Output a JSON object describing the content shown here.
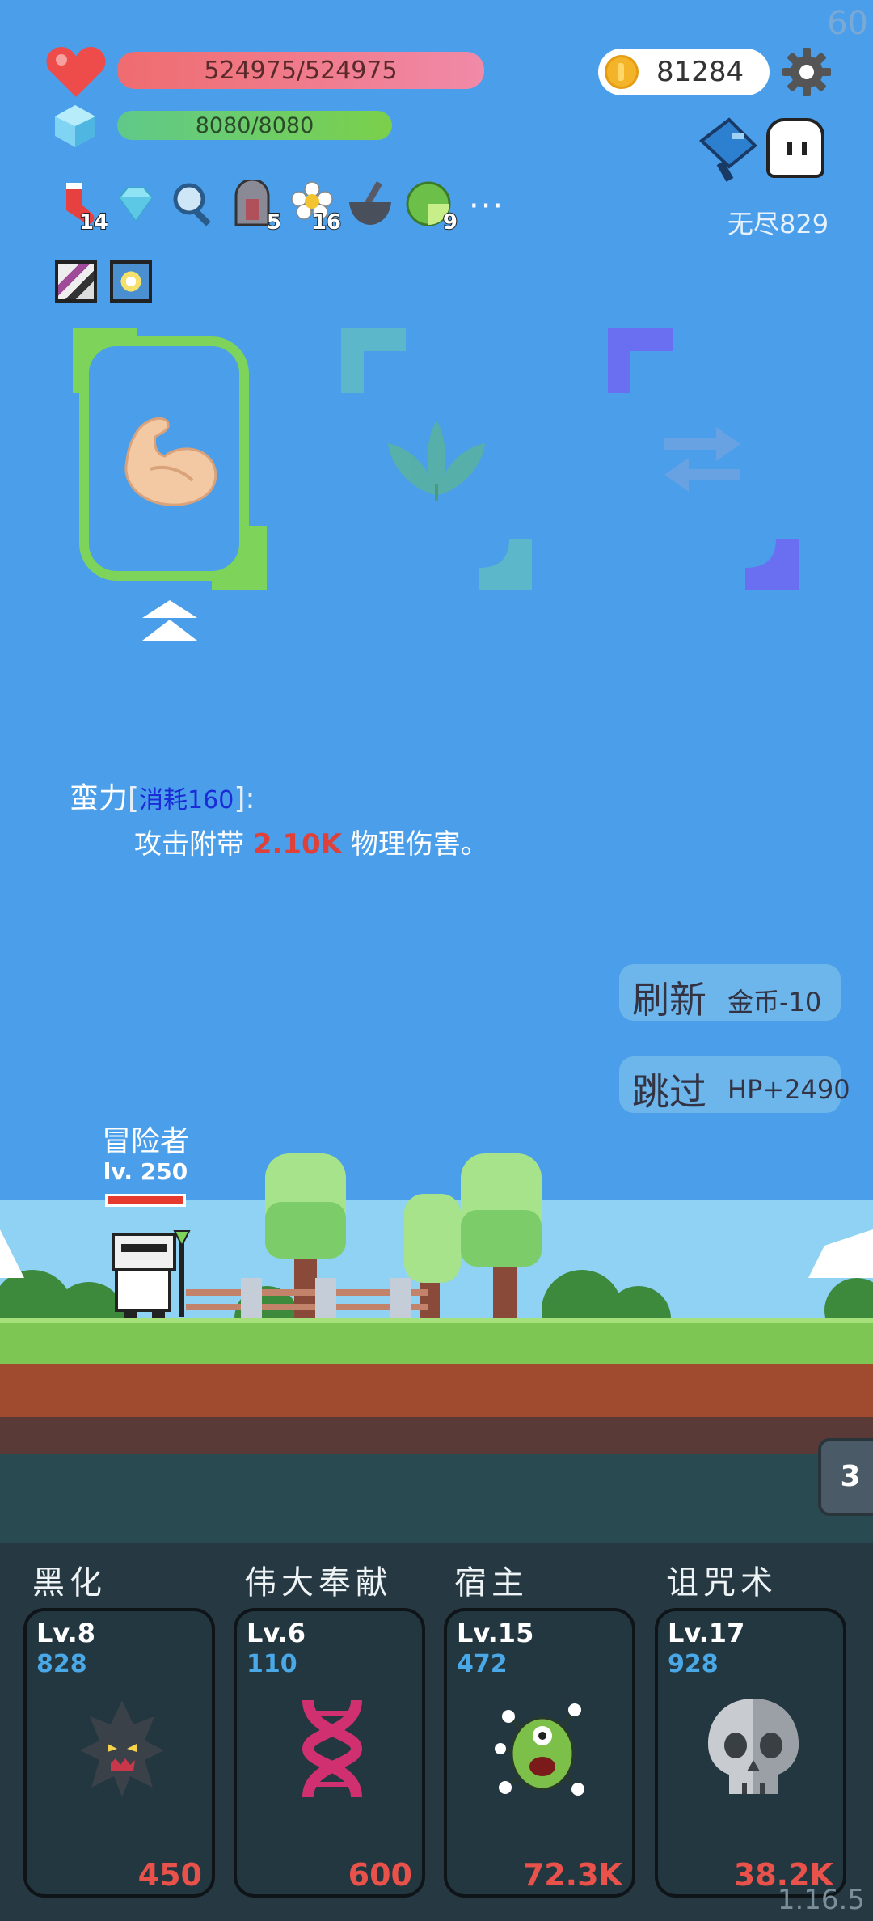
{
  "hud": {
    "fps": "60",
    "hp_text": "524975/524975",
    "mp_text": "8080/8080",
    "gold": "81284",
    "endless": "无尽829",
    "version": "1.16.5"
  },
  "items": [
    {
      "icon": "sock-icon",
      "count": "14"
    },
    {
      "icon": "diamond-icon",
      "count": ""
    },
    {
      "icon": "magnifier-icon",
      "count": ""
    },
    {
      "icon": "tombstone-icon",
      "count": "5"
    },
    {
      "icon": "egg-flower-icon",
      "count": "16"
    },
    {
      "icon": "mortar-icon",
      "count": ""
    },
    {
      "icon": "lime-icon",
      "count": "9"
    }
  ],
  "more": "···",
  "skill_desc": {
    "name": "蛮力",
    "cost": "消耗160",
    "line_prefix": "攻击附带",
    "damage": "2.10K",
    "line_suffix": "物理伤害。"
  },
  "buttons": {
    "refresh_main": "刷新",
    "refresh_sub": "金币-10",
    "skip_main": "跳过",
    "skip_sub": "HP+2490"
  },
  "player": {
    "name": "冒险者",
    "level": "lv. 250"
  },
  "side_badge": "3",
  "cards": [
    {
      "label": "黑化",
      "lv": "Lv.8",
      "value": "828",
      "cost": "450",
      "icon": "dark-tree-icon"
    },
    {
      "label": "伟大奉献",
      "lv": "Lv.6",
      "value": "110",
      "cost": "600",
      "icon": "dna-icon"
    },
    {
      "label": "宿主",
      "lv": "Lv.15",
      "value": "472",
      "cost": "72.3K",
      "icon": "green-monster-icon"
    },
    {
      "label": "诅咒术",
      "lv": "Lv.17",
      "value": "928",
      "cost": "38.2K",
      "icon": "skull-icon"
    }
  ],
  "colors": {
    "sky": "#4a9eea",
    "hp": "#ef6c6f",
    "mp": "#7bd04a",
    "card_bg": "#233741",
    "cost_red": "#e8524b",
    "value_blue": "#4aa8e6"
  }
}
